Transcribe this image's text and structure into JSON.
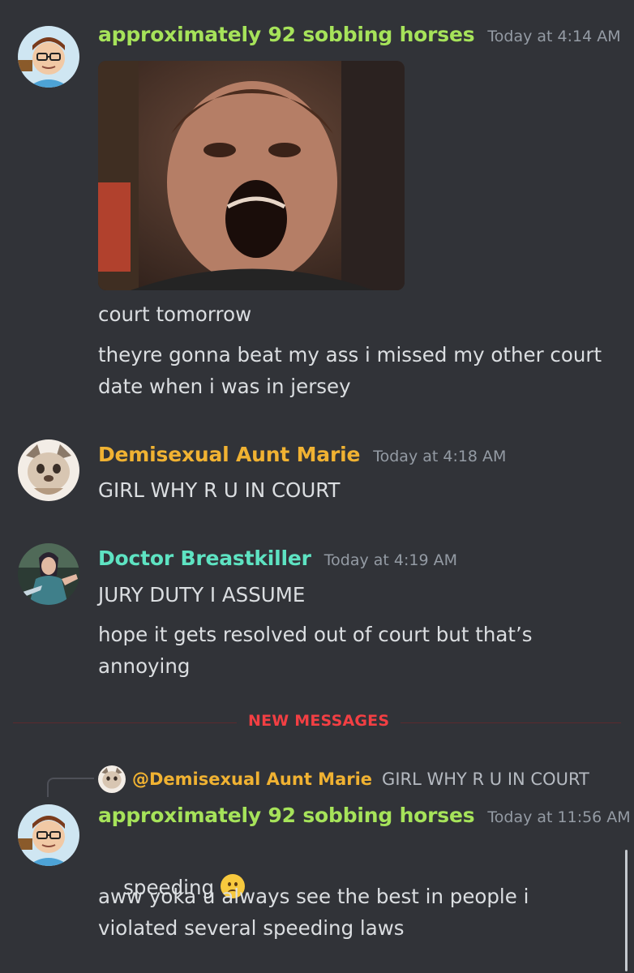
{
  "messages": [
    {
      "author": "approximately 92 sobbing horses",
      "author_color": "#a6e35a",
      "timestamp": "Today at 4:14 AM",
      "attachment": "image-attachment-screaming-man",
      "lines": [
        "court tomorrow",
        "theyre gonna beat my ass i missed my other court date when i was in jersey"
      ]
    },
    {
      "author": "Demisexual Aunt Marie",
      "author_color": "#f0b232",
      "timestamp": "Today at 4:18 AM",
      "lines": [
        "GIRL WHY R U IN COURT"
      ]
    },
    {
      "author": "Doctor Breastkiller",
      "author_color": "#5ee3c2",
      "timestamp": "Today at 4:19 AM",
      "lines": [
        "JURY DUTY I ASSUME",
        "hope it gets resolved out of court but that’s annoying"
      ]
    },
    {
      "author": "approximately 92 sobbing horses",
      "author_color": "#a6e35a",
      "timestamp": "Today at 11:56 AM",
      "reply": {
        "author": "@Demisexual Aunt Marie",
        "text": "GIRL WHY R U IN COURT"
      },
      "lines": [
        "speeding",
        "aww yoka u always see the best in people i violated several speeding laws"
      ],
      "emoji": "frowning-face-emoji"
    }
  ],
  "divider": {
    "label": "NEW MESSAGES",
    "color": "#f23f43"
  }
}
